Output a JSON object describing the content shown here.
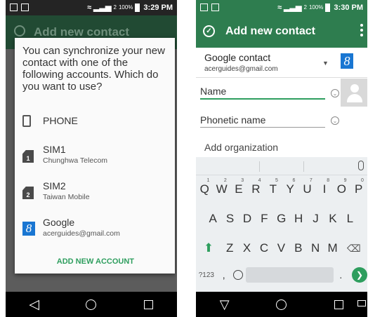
{
  "left": {
    "status": {
      "time": "3:29 PM",
      "battery": "100%",
      "signal": "2"
    },
    "header_title": "Add new contact",
    "dialog": {
      "message": "You can synchronize your new contact with one of the following accounts. Which do you want to use?",
      "options": [
        {
          "title": "PHONE",
          "subtitle": "",
          "icon": "phone-icon"
        },
        {
          "title": "SIM1",
          "subtitle": "Chunghwa Telecom",
          "icon": "sim-card-icon",
          "badge": "1"
        },
        {
          "title": "SIM2",
          "subtitle": "Taiwan Mobile",
          "icon": "sim-card-icon",
          "badge": "2"
        },
        {
          "title": "Google",
          "subtitle": "acerguides@gmail.com",
          "icon": "google-icon",
          "badge": "8"
        }
      ],
      "add_account": "ADD NEW ACCOUNT"
    }
  },
  "right": {
    "status": {
      "time": "3:30 PM",
      "battery": "100%",
      "signal": "2"
    },
    "app_title": "Add new contact",
    "account": {
      "title": "Google contact",
      "email": "acerguides@gmail.com",
      "badge": "8"
    },
    "fields": {
      "name": "Name",
      "phonetic": "Phonetic name",
      "organization": "Add organization"
    },
    "keyboard": {
      "row1": [
        {
          "k": "Q",
          "s": "1"
        },
        {
          "k": "W",
          "s": "2"
        },
        {
          "k": "E",
          "s": "3"
        },
        {
          "k": "R",
          "s": "4"
        },
        {
          "k": "T",
          "s": "5"
        },
        {
          "k": "Y",
          "s": "6"
        },
        {
          "k": "U",
          "s": "7"
        },
        {
          "k": "I",
          "s": "8"
        },
        {
          "k": "O",
          "s": "9"
        },
        {
          "k": "P",
          "s": "0"
        }
      ],
      "row2": [
        "A",
        "S",
        "D",
        "F",
        "G",
        "H",
        "J",
        "K",
        "L"
      ],
      "row3": [
        "Z",
        "X",
        "C",
        "V",
        "B",
        "N",
        "M"
      ],
      "symbols": "?123",
      "comma": ",",
      "period": "."
    }
  }
}
